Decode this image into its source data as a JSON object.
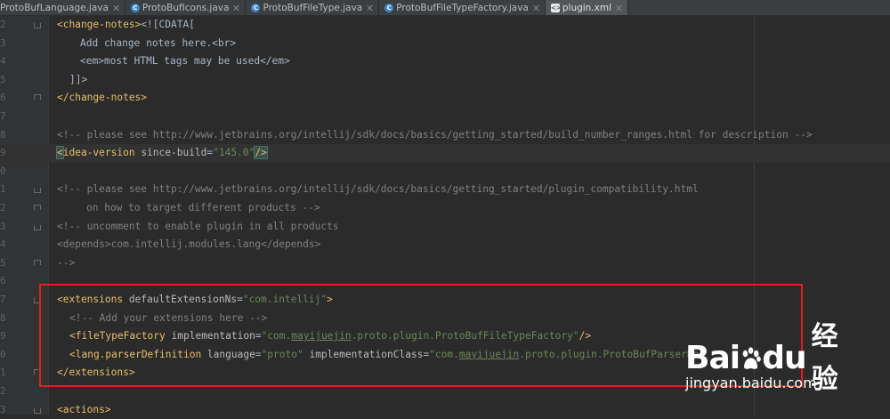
{
  "tabs": [
    {
      "label": "ProtoBufLanguage.java",
      "icon": "java-class-icon"
    },
    {
      "label": "ProtoBufIcons.java",
      "icon": "java-class-icon"
    },
    {
      "label": "ProtoBufFileType.java",
      "icon": "java-class-icon"
    },
    {
      "label": "ProtoBufFileTypeFactory.java",
      "icon": "java-class-icon"
    },
    {
      "label": "plugin.xml",
      "icon": "xml-file-icon",
      "active": true
    }
  ],
  "gutter": {
    "line_numbers": [
      "2",
      "3",
      "4",
      "5",
      "6",
      "7",
      "8",
      "9",
      "0",
      "1",
      "2",
      "3",
      "4",
      "5",
      "6",
      "7",
      "8",
      "9",
      "0",
      "1",
      "2",
      "3"
    ]
  },
  "code_lines": {
    "l0": [
      "<change-notes>",
      "<![CDATA["
    ],
    "l1": [
      "Add change notes here.<br>"
    ],
    "l2": [
      "<em>most HTML tags may be used</em>"
    ],
    "l3": [
      "]]>"
    ],
    "l4": [
      "</change-notes>"
    ],
    "l6": [
      "<!-- please see http://www.jetbrains.org/intellij/sdk/docs/basics/getting_started/build_number_ranges.html for description -->"
    ],
    "l7": [
      "<",
      "idea-version",
      " since-build",
      "=",
      "\"145.0\"",
      "/>"
    ],
    "l9": [
      "<!-- please see http://www.jetbrains.org/intellij/sdk/docs/basics/getting_started/plugin_compatibility.html"
    ],
    "l10": [
      "on how to target different products -->"
    ],
    "l11": [
      "<!-- uncomment to enable plugin in all products"
    ],
    "l12": [
      "<depends>com.intellij.modules.lang</depends>"
    ],
    "l13": [
      "-->"
    ],
    "l15": [
      "<extensions",
      " defaultExtensionNs",
      "=",
      "\"com.intellij\"",
      ">"
    ],
    "l16": [
      "<!-- Add your extensions here -->"
    ],
    "l17": [
      "<fileTypeFactory",
      " implementation",
      "=",
      "\"com.",
      "mayijuejin",
      ".proto.plugin.ProtoBufFileTypeFactory\"",
      "/>"
    ],
    "l18": [
      "<lang.parserDefinition",
      " language",
      "=",
      "\"proto\"",
      " implementationClass",
      "=",
      "\"com.",
      "mayijuejin",
      ".proto.plugin.ProtoBufParserDe"
    ],
    "l19": [
      "</extensions>"
    ],
    "l21": [
      "<actions>"
    ]
  },
  "watermark": {
    "logo_bai": "Bai",
    "logo_du": "du",
    "logo_cn": "经验",
    "url": "jingyan.baidu.com"
  },
  "colors": {
    "editor_bg": "#2b2b2b",
    "tag": "#e8bf6a",
    "attribute": "#bababa",
    "attr_value": "#6a8759",
    "comment": "#808080",
    "highlight_box": "#e02020"
  }
}
